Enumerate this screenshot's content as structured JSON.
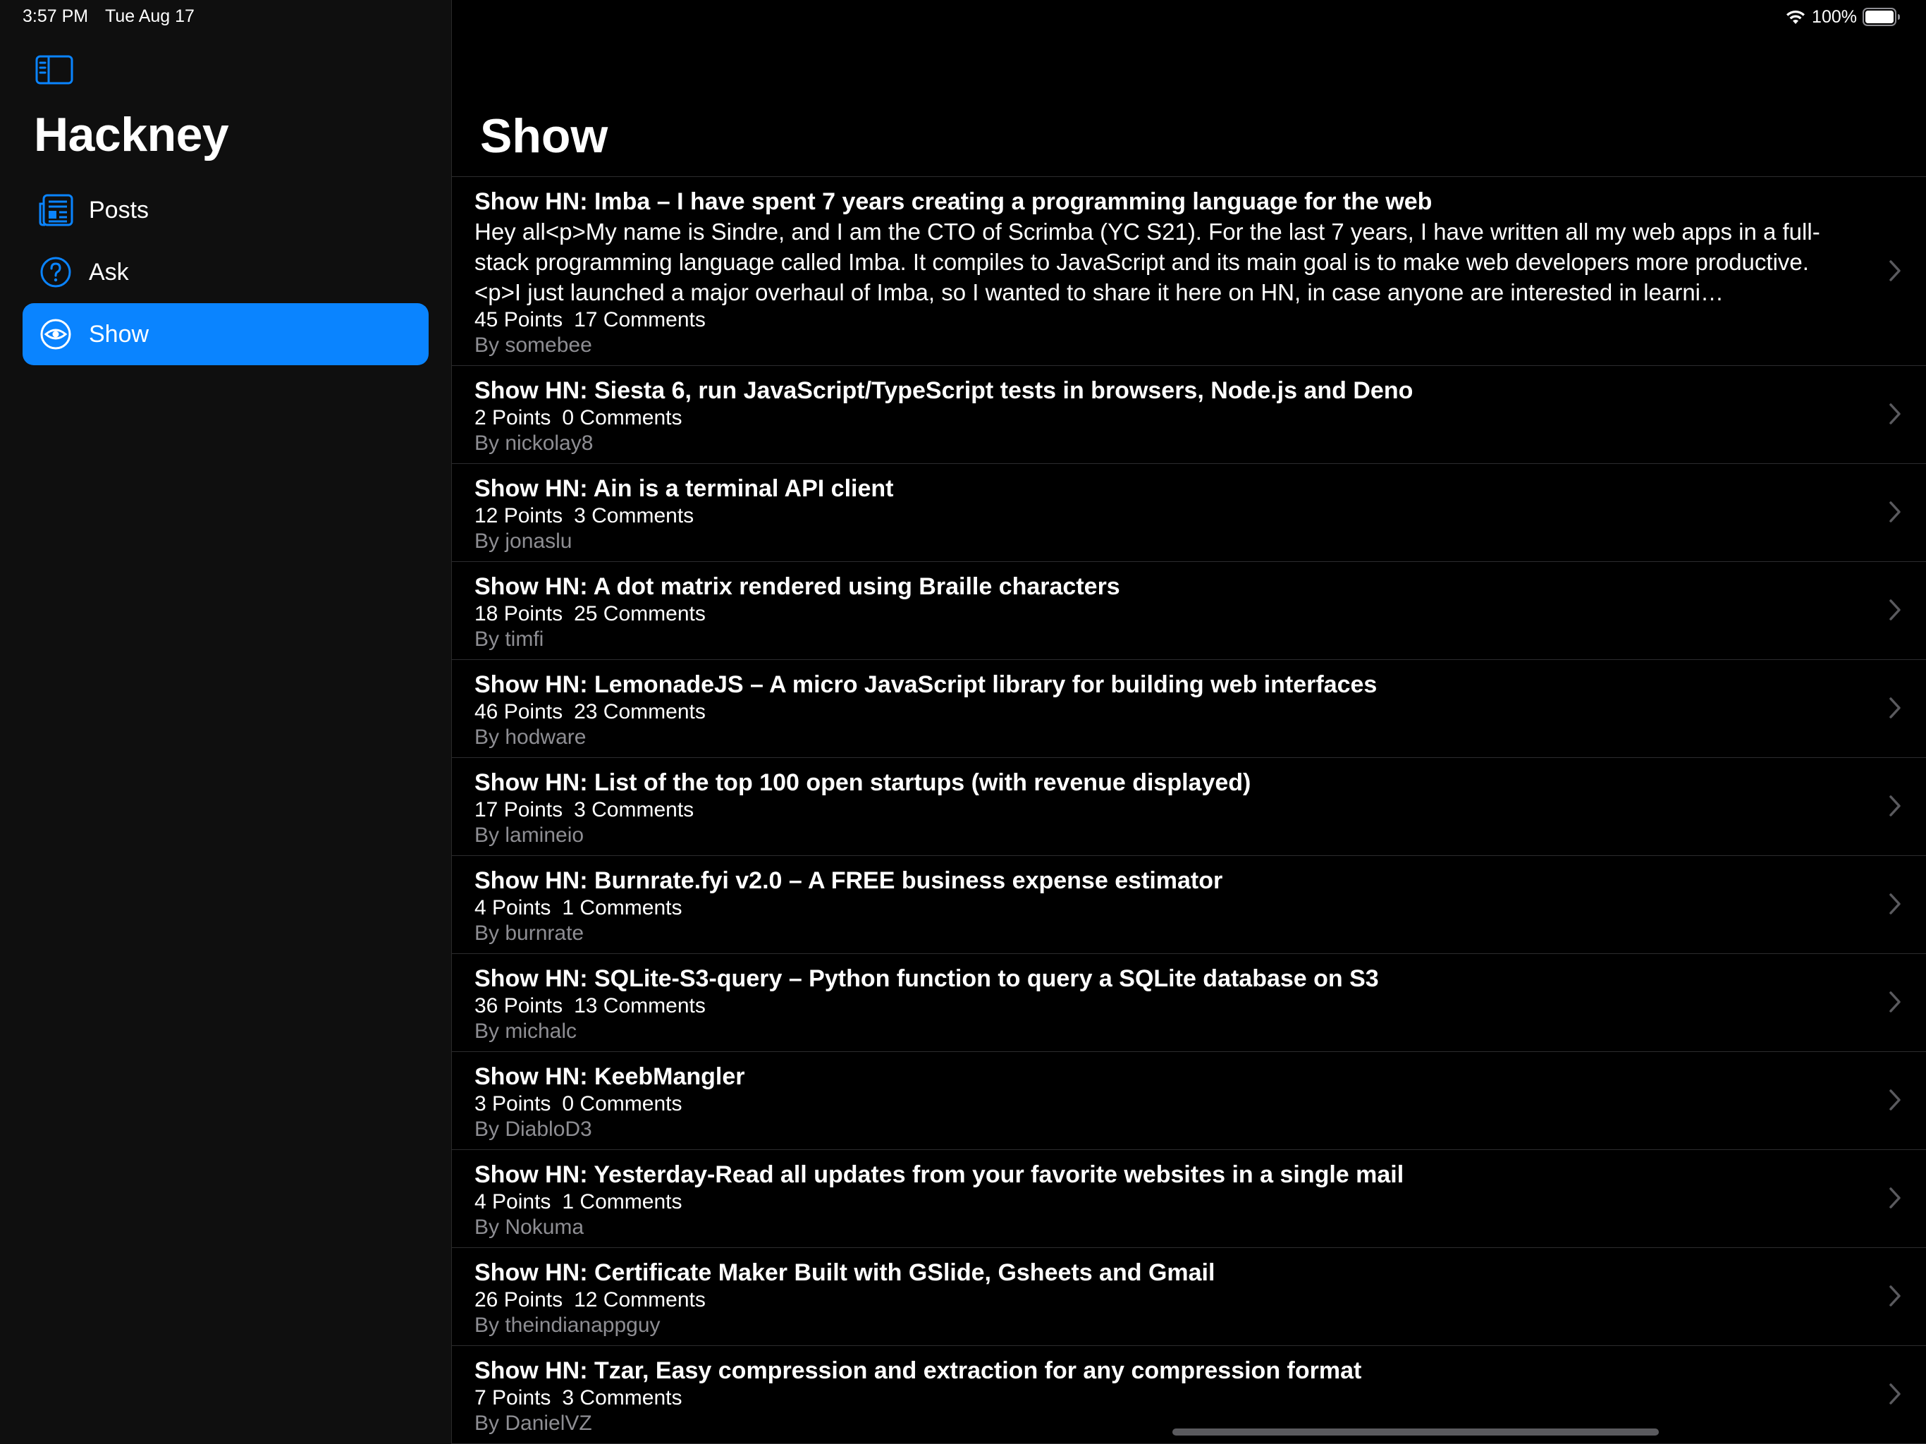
{
  "status": {
    "time": "3:57 PM",
    "date": "Tue Aug 17",
    "battery": "100%"
  },
  "sidebar": {
    "app_title": "Hackney",
    "items": [
      {
        "label": "Posts",
        "icon": "newspaper-icon",
        "selected": false
      },
      {
        "label": "Ask",
        "icon": "question-circle-icon",
        "selected": false
      },
      {
        "label": "Show",
        "icon": "eye-icon",
        "selected": true
      }
    ]
  },
  "colors": {
    "accent": "#0a84ff",
    "background": "#000000",
    "sidebar_bg": "#0f0f0f",
    "secondary_text": "#8e8e93"
  },
  "main": {
    "title": "Show",
    "posts": [
      {
        "title": "Show HN: Imba – I have spent 7 years creating a programming language for the web",
        "body": "Hey all<p>My name is Sindre, and I am the CTO of Scrimba (YC S21). For the last 7 years, I have written all my web apps in a full-stack programming language called Imba. It compiles to JavaScript and its main goal is to make web developers more productive.<p>I just launched a major overhaul of Imba, so I wanted to share it here on HN, in case anyone are interested in learni…",
        "points": "45 Points",
        "comments": "17 Comments",
        "author": "By somebee"
      },
      {
        "title": "Show HN: Siesta 6, run JavaScript/TypeScript tests in browsers, Node.js and Deno",
        "points": "2 Points",
        "comments": "0 Comments",
        "author": "By nickolay8"
      },
      {
        "title": "Show HN: Ain is a terminal API client",
        "points": "12 Points",
        "comments": "3 Comments",
        "author": "By jonaslu"
      },
      {
        "title": "Show HN: A dot matrix rendered using Braille characters",
        "points": "18 Points",
        "comments": "25 Comments",
        "author": "By timfi"
      },
      {
        "title": "Show HN: LemonadeJS – A micro JavaScript library for building web interfaces",
        "points": "46 Points",
        "comments": "23 Comments",
        "author": "By hodware"
      },
      {
        "title": "Show HN: List of the top 100 open startups (with revenue displayed)",
        "points": "17 Points",
        "comments": "3 Comments",
        "author": "By lamineio"
      },
      {
        "title": "Show HN: Burnrate.fyi v2.0 – A FREE business expense estimator",
        "points": "4 Points",
        "comments": "1 Comments",
        "author": "By burnrate"
      },
      {
        "title": "Show HN: SQLite-S3-query – Python function to query a SQLite database on S3",
        "points": "36 Points",
        "comments": "13 Comments",
        "author": "By michalc"
      },
      {
        "title": "Show HN: KeebMangler",
        "points": "3 Points",
        "comments": "0 Comments",
        "author": "By DiabloD3"
      },
      {
        "title": "Show HN: Yesterday-Read all updates from your favorite websites in a single mail",
        "points": "4 Points",
        "comments": "1 Comments",
        "author": "By Nokuma"
      },
      {
        "title": "Show HN: Certificate Maker Built with GSlide, Gsheets and Gmail",
        "points": "26 Points",
        "comments": "12 Comments",
        "author": "By theindianappguy"
      },
      {
        "title": "Show HN: Tzar, Easy compression and extraction for any compression format",
        "points": "7 Points",
        "comments": "3 Comments",
        "author": "By DanielVZ"
      }
    ]
  }
}
